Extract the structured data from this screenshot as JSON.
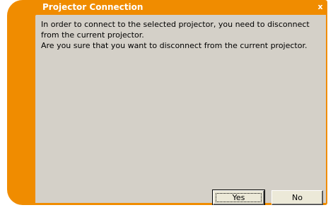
{
  "window": {
    "title": "Projector Connection",
    "close_label": "x"
  },
  "message": {
    "line1": "In order to connect to the selected projector, you need to disconnect from the current projector.",
    "line2": "Are you sure that you want to disconnect from the current projector."
  },
  "buttons": {
    "yes_label": "Yes",
    "no_label": "No"
  },
  "colors": {
    "accent": "#f08c00",
    "panel": "#d4d0c8"
  }
}
